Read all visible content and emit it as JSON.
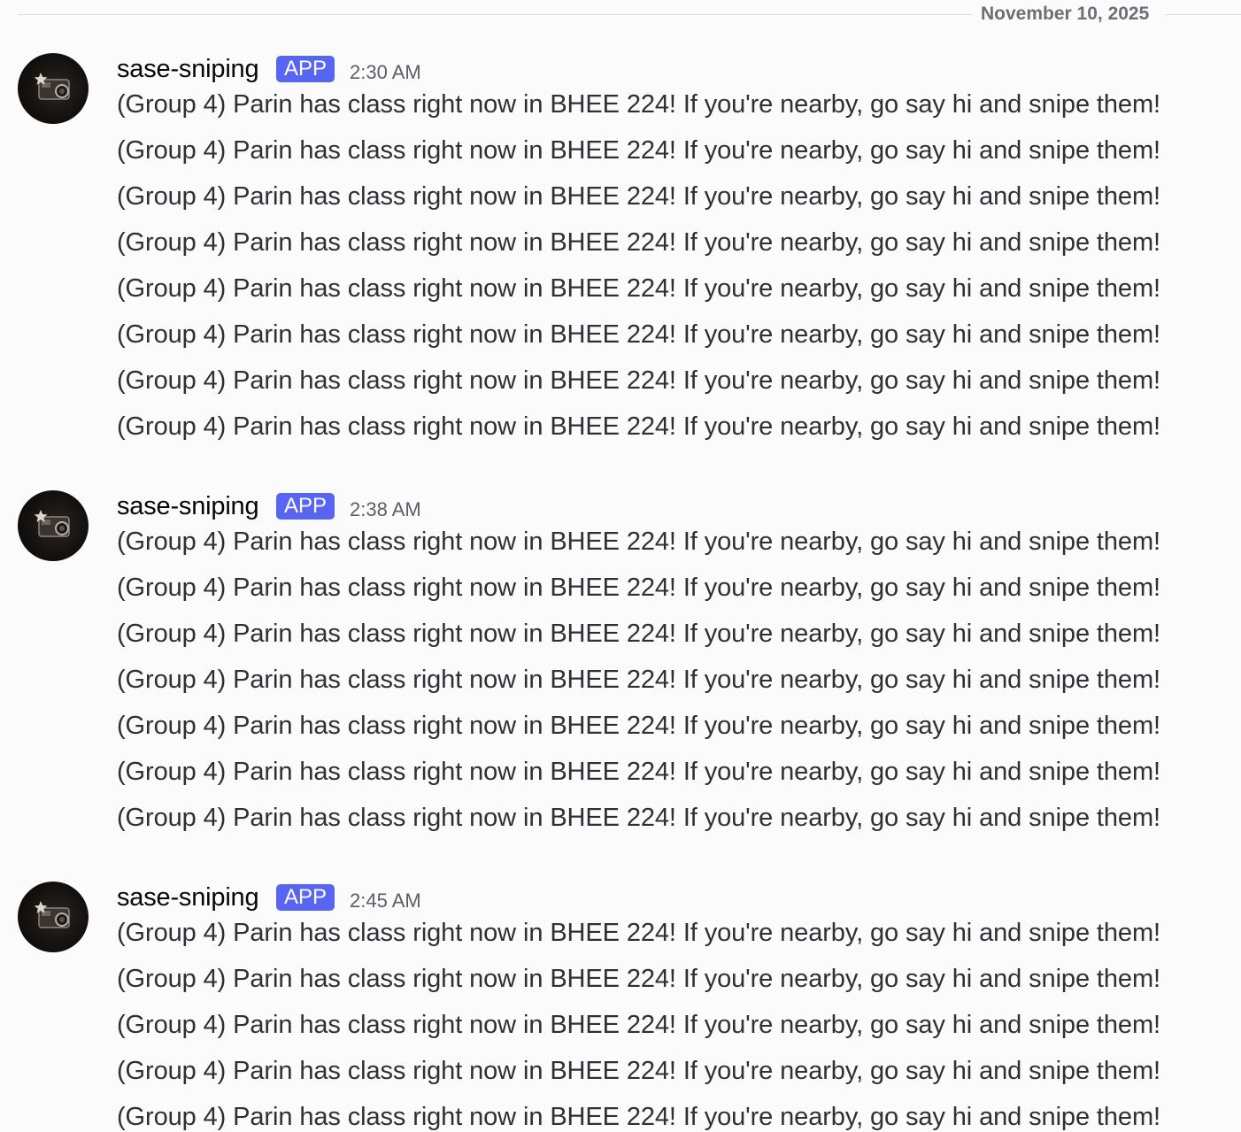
{
  "date_divider": "November 10, 2025",
  "groups": [
    {
      "username": "sase-sniping",
      "badge": "APP",
      "time": "2:30 AM",
      "lines": [
        "(Group 4) Parin has class right now in BHEE 224! If you're nearby, go say hi and snipe them!",
        "(Group 4) Parin has class right now in BHEE 224! If you're nearby, go say hi and snipe them!",
        "(Group 4) Parin has class right now in BHEE 224! If you're nearby, go say hi and snipe them!",
        "(Group 4) Parin has class right now in BHEE 224! If you're nearby, go say hi and snipe them!",
        "(Group 4) Parin has class right now in BHEE 224! If you're nearby, go say hi and snipe them!",
        "(Group 4) Parin has class right now in BHEE 224! If you're nearby, go say hi and snipe them!",
        "(Group 4) Parin has class right now in BHEE 224! If you're nearby, go say hi and snipe them!",
        "(Group 4) Parin has class right now in BHEE 224! If you're nearby, go say hi and snipe them!"
      ]
    },
    {
      "username": "sase-sniping",
      "badge": "APP",
      "time": "2:38 AM",
      "lines": [
        "(Group 4) Parin has class right now in BHEE 224! If you're nearby, go say hi and snipe them!",
        "(Group 4) Parin has class right now in BHEE 224! If you're nearby, go say hi and snipe them!",
        "(Group 4) Parin has class right now in BHEE 224! If you're nearby, go say hi and snipe them!",
        "(Group 4) Parin has class right now in BHEE 224! If you're nearby, go say hi and snipe them!",
        "(Group 4) Parin has class right now in BHEE 224! If you're nearby, go say hi and snipe them!",
        "(Group 4) Parin has class right now in BHEE 224! If you're nearby, go say hi and snipe them!",
        "(Group 4) Parin has class right now in BHEE 224! If you're nearby, go say hi and snipe them!"
      ]
    },
    {
      "username": "sase-sniping",
      "badge": "APP",
      "time": "2:45 AM",
      "lines": [
        "(Group 4) Parin has class right now in BHEE 224! If you're nearby, go say hi and snipe them!",
        "(Group 4) Parin has class right now in BHEE 224! If you're nearby, go say hi and snipe them!",
        "(Group 4) Parin has class right now in BHEE 224! If you're nearby, go say hi and snipe them!",
        "(Group 4) Parin has class right now in BHEE 224! If you're nearby, go say hi and snipe them!",
        "(Group 4) Parin has class right now in BHEE 224! If you're nearby, go say hi and snipe them!"
      ]
    }
  ],
  "icons": {
    "avatar": "bot-avatar-camera-icon"
  }
}
